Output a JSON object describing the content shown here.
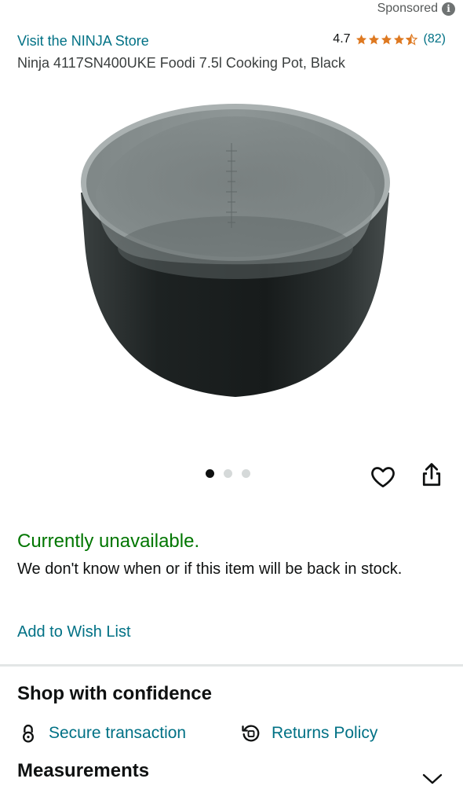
{
  "header": {
    "sponsored_label": "Sponsored",
    "info_icon": "info-icon"
  },
  "store": {
    "link_text": "Visit the NINJA Store"
  },
  "rating": {
    "value": "4.7",
    "stars": 4.5,
    "count": "(82)"
  },
  "product": {
    "title": "Ninja 4117SN400UKE Foodi 7.5l Cooking Pot, Black",
    "image_alt": "Black cooking pot with grey non-stick interior",
    "image_count": 3,
    "active_image": 1
  },
  "actions": {
    "wishlist_icon": "heart-icon",
    "share_icon": "share-icon"
  },
  "availability": {
    "status": "Currently unavailable.",
    "message": "We don't know when or if this item will be back in stock.",
    "wishlist_link": "Add to Wish List"
  },
  "confidence": {
    "heading": "Shop with confidence",
    "secure_label": "Secure transaction",
    "returns_label": "Returns Policy"
  },
  "measurements": {
    "heading": "Measurements"
  },
  "colors": {
    "link": "#007185",
    "available": "#007600",
    "star": "#de7921"
  }
}
